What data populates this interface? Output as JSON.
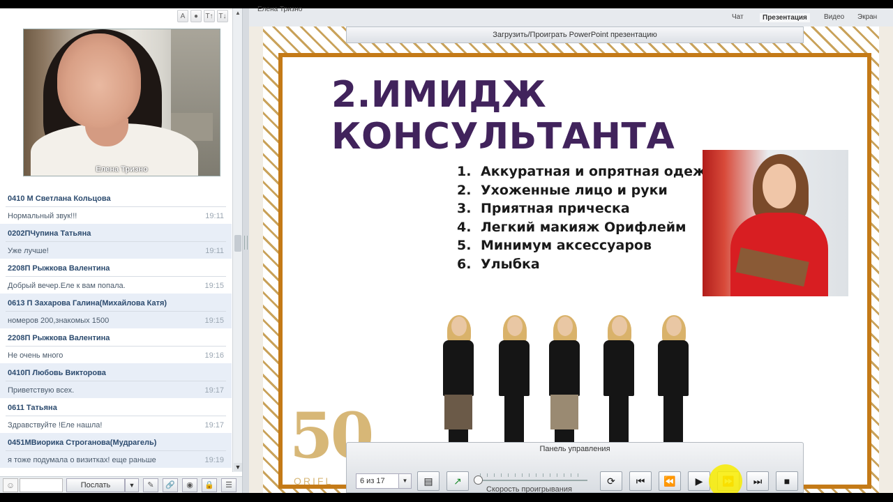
{
  "presenter": {
    "name": "Елена Тризно"
  },
  "video": {
    "caption": "Елена Тризно"
  },
  "cam_toolbar": [
    "A",
    "●",
    "T↑",
    "T↓"
  ],
  "chat": {
    "messages": [
      {
        "author": "0410 М Светлана Кольцова",
        "text": "Нормальный звук!!!",
        "time": "19:11"
      },
      {
        "author": "0202ПЧупина Татьяна",
        "text": "Уже лучше!",
        "time": "19:11"
      },
      {
        "author": "2208П Рыжкова Валентина",
        "text": "Добрый вечер.Еле к вам попала.",
        "time": "19:15"
      },
      {
        "author": "0613 П Захарова Галина(Михайлова Катя)",
        "text": "номеров 200,знакомых 1500",
        "time": "19:15"
      },
      {
        "author": "2208П Рыжкова Валентина",
        "text": "Не очень много",
        "time": "19:16"
      },
      {
        "author": "0410П Любовь Викторова",
        "text": "Приветствую  всех.",
        "time": "19:17"
      },
      {
        "author": "0611 Татьяна",
        "text": "Здравствуйте !Еле нашла!",
        "time": "19:17"
      },
      {
        "author": "0451МВиорика Строганова(Мудрагель)",
        "text": "я тоже подумала о визитках! еще раньше",
        "time": "19:19"
      }
    ],
    "send_label": "Послать"
  },
  "tabs": {
    "chat": "Чат",
    "presentation": "Презентация",
    "video": "Видео",
    "screen": "Экран"
  },
  "load_ppt_label": "Загрузить/Проиграть PowerPoint презентацию",
  "slide": {
    "title": "2.ИМИДЖ КОНСУЛЬТАНТА",
    "items": [
      {
        "num": "1.",
        "text": "Аккуратная и опрятная одежда"
      },
      {
        "num": "2.",
        "text": "Ухоженные лицо и руки"
      },
      {
        "num": "3.",
        "text": "Приятная прическа"
      },
      {
        "num": "4.",
        "text": "Легкий макияж Орифлейм"
      },
      {
        "num": "5.",
        "text": "Минимум аксессуаров"
      },
      {
        "num": "6.",
        "text": "Улыбка"
      }
    ],
    "logo_number": "50",
    "logo_brand": "ORIFL"
  },
  "control_panel": {
    "title": "Панель управления",
    "slide_counter": "6 из 17",
    "speed_label": "Скорость проигрывания",
    "speed_level": 0
  },
  "colors": {
    "title": "#41235c",
    "frame": "#c47a17",
    "gold": "#d7b777",
    "highlight": "#f8ec00"
  }
}
